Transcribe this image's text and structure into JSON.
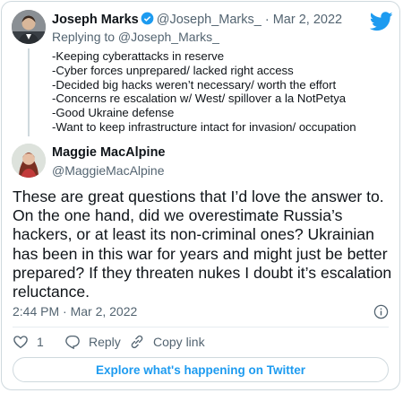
{
  "colors": {
    "accent": "#1d9bf0",
    "text": "#0f1419",
    "muted": "#536471",
    "border": "#cfd9de"
  },
  "tweet1": {
    "name": "Joseph Marks",
    "handle": "@Joseph_Marks_",
    "separator": "·",
    "date": "Mar 2, 2022",
    "replying_to": "Replying to @Joseph_Marks_",
    "verified_icon": "verified-badge-icon",
    "lines": [
      "-Keeping cyberattacks in reserve",
      "-Cyber forces unprepared/ lacked right access",
      "-Decided big hacks weren’t necessary/ worth the effort",
      "-Concerns re escalation w/ West/ spillover a la NotPetya",
      "-Good Ukraine defense",
      "-Want to keep infrastructure intact for invasion/ occupation"
    ]
  },
  "tweet2": {
    "name": "Maggie MacAlpine",
    "handle": "@MaggieMacAlpine",
    "lines": [
      "These are great questions that I’d love the answer to.",
      "On the one hand, did we overestimate Russia’s",
      "hackers, or at least its non-criminal ones? Ukrainian",
      "has been in this war for years and might just be better",
      "prepared? If they threaten nukes I doubt it’s escalation",
      "reluctance."
    ],
    "timestamp": "2:44 PM · Mar 2, 2022"
  },
  "actions": {
    "like_count": "1",
    "reply_label": "Reply",
    "copy_label": "Copy link"
  },
  "explore_label": "Explore what's happening on Twitter"
}
